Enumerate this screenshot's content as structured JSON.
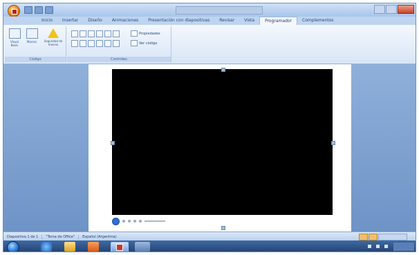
{
  "window": {
    "title": "",
    "controls": [
      "minimize",
      "maximize",
      "close"
    ]
  },
  "ribbon": {
    "tabs": [
      {
        "label": "Inicio",
        "active": false
      },
      {
        "label": "Insertar",
        "active": false
      },
      {
        "label": "Diseño",
        "active": false
      },
      {
        "label": "Animaciones",
        "active": false
      },
      {
        "label": "Presentación con diapositivas",
        "active": false
      },
      {
        "label": "Revisar",
        "active": false
      },
      {
        "label": "Vista",
        "active": false
      },
      {
        "label": "Programador",
        "active": true
      },
      {
        "label": "Complementos",
        "active": false
      }
    ],
    "groups": {
      "code": {
        "label": "Código",
        "buttons": [
          {
            "label": "Visual Basic",
            "icon": "visual-basic-icon"
          },
          {
            "label": "Macros",
            "icon": "macros-icon"
          },
          {
            "label": "Seguridad de macros",
            "icon": "warning-icon"
          }
        ]
      },
      "controls": {
        "label": "Controles",
        "properties_label": "Propiedades",
        "view_code_label": "Ver código"
      }
    }
  },
  "statusbar": {
    "slide": "Diapositiva 1 de 1",
    "theme": "\"Tema de Office\"",
    "language": "Español (Argentina)"
  },
  "taskbar": {
    "pinned": [
      "internet-explorer-icon",
      "folder-icon",
      "media-player-icon",
      "powerpoint-icon",
      "window-icon"
    ]
  },
  "colors": {
    "video_background": "#000000",
    "workspace": "#7d9fd0",
    "ribbon": "#dfeaf8",
    "taskbar": "#2f5185"
  }
}
